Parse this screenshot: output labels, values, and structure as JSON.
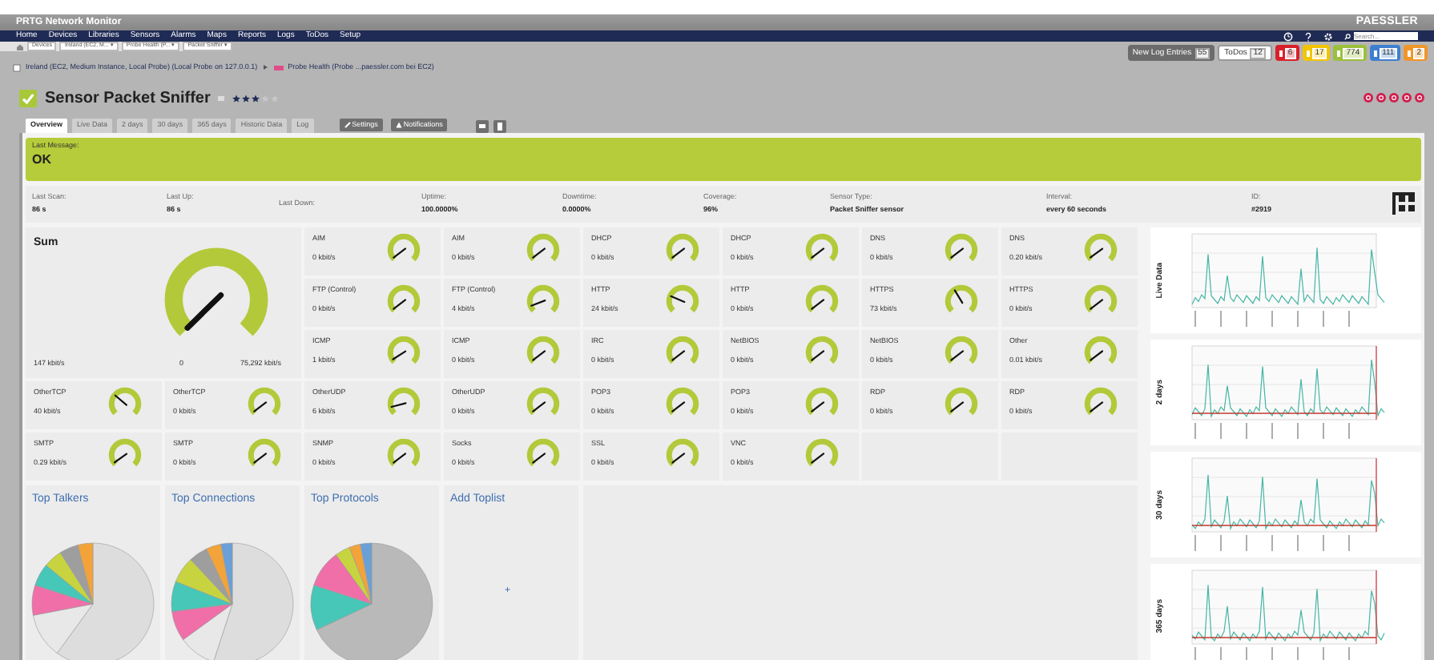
{
  "app_title": "PRTG Network Monitor",
  "logo": "PAESSLER",
  "menu": [
    "Home",
    "Devices",
    "Libraries",
    "Sensors",
    "Alarms",
    "Maps",
    "Reports",
    "Logs",
    "ToDos",
    "Setup"
  ],
  "search": {
    "placeholder": "Search..."
  },
  "breadcrumbs": [
    "Devices",
    "Ireland (EC2, M... ▾",
    "Probe Health (P... ▾",
    "Packet Sniffer ▾"
  ],
  "badges": [
    {
      "kind": "log",
      "label": "New Log Entries",
      "count": "55"
    },
    {
      "kind": "todo",
      "label": "ToDos",
      "count": "12"
    },
    {
      "kind": "status",
      "count": "6",
      "color": "#d9202a"
    },
    {
      "kind": "status",
      "count": "17",
      "color": "#f2c500"
    },
    {
      "kind": "status",
      "count": "774",
      "color": "#9cc03c"
    },
    {
      "kind": "status",
      "count": "111",
      "color": "#3f7fd0"
    },
    {
      "kind": "status",
      "count": "2",
      "color": "#f0962a"
    }
  ],
  "path": [
    "Ireland (EC2, Medium Instance, Local Probe) (Local Probe on 127.0.0.1)",
    "Probe Health (Probe ...paessler.com bei EC2)"
  ],
  "sensor": {
    "title": "Sensor Packet Sniffer",
    "stars": 3
  },
  "tabs": [
    {
      "label": "Overview",
      "selected": true
    },
    {
      "label": "Live Data",
      "selected": false
    },
    {
      "label": "2 days",
      "selected": false
    },
    {
      "label": "30 days",
      "selected": false
    },
    {
      "label": "365 days",
      "selected": false
    },
    {
      "label": "Historic Data",
      "selected": false
    },
    {
      "label": "Log",
      "selected": false
    }
  ],
  "actions": [
    "Settings",
    "Notifications"
  ],
  "last_message": {
    "label": "Last Message:",
    "value": "OK"
  },
  "info": [
    {
      "label": "Last Scan:",
      "value": "86 s"
    },
    {
      "label": "Last Up:",
      "value": "86 s"
    },
    {
      "label": "Last Down:"
    },
    {
      "label": "Uptime:",
      "value": "100.0000%"
    },
    {
      "label": "Downtime:",
      "value": "0.0000%"
    },
    {
      "label": "Coverage:",
      "value": "96%"
    },
    {
      "label": "Sensor Type:",
      "value": "Packet Sniffer sensor"
    },
    {
      "label": "Interval:",
      "value": "every 60 seconds"
    },
    {
      "label": "ID:",
      "value": "#2919"
    }
  ],
  "sum_gauge": {
    "title": "Sum",
    "reading": "147 kbit/s",
    "min": "0",
    "max": "75,292 kbit/s"
  },
  "gauges": [
    {
      "name": "AIM",
      "reading": "0 kbit/s"
    },
    {
      "name": "AIM",
      "reading": "0 kbit/s"
    },
    {
      "name": "DHCP",
      "reading": "0 kbit/s"
    },
    {
      "name": "DHCP",
      "reading": "0 kbit/s"
    },
    {
      "name": "DNS",
      "reading": "0 kbit/s"
    },
    {
      "name": "DNS",
      "reading": "0.20 kbit/s"
    },
    {
      "name": "FTP (Control)",
      "reading": "0 kbit/s"
    },
    {
      "name": "FTP (Control)",
      "reading": "4 kbit/s"
    },
    {
      "name": "HTTP",
      "reading": "24 kbit/s"
    },
    {
      "name": "HTTP",
      "reading": "0 kbit/s"
    },
    {
      "name": "HTTPS",
      "reading": "73 kbit/s"
    },
    {
      "name": "HTTPS",
      "reading": "0 kbit/s"
    },
    {
      "name": "ICMP",
      "reading": "1 kbit/s"
    },
    {
      "name": "ICMP",
      "reading": "0 kbit/s"
    },
    {
      "name": "IRC",
      "reading": "0 kbit/s"
    },
    {
      "name": "NetBIOS",
      "reading": "0 kbit/s"
    },
    {
      "name": "NetBIOS",
      "reading": "0 kbit/s"
    },
    {
      "name": "Other",
      "reading": "0.01 kbit/s"
    },
    {
      "name": "OtherTCP",
      "reading": "40 kbit/s"
    },
    {
      "name": "OtherTCP",
      "reading": "0 kbit/s"
    },
    {
      "name": "OtherUDP",
      "reading": "6 kbit/s"
    },
    {
      "name": "OtherUDP",
      "reading": "0 kbit/s"
    },
    {
      "name": "POP3",
      "reading": "0 kbit/s"
    },
    {
      "name": "POP3",
      "reading": "0 kbit/s"
    },
    {
      "name": "RDP",
      "reading": "0 kbit/s"
    },
    {
      "name": "RDP",
      "reading": "0 kbit/s"
    },
    {
      "name": "SMTP",
      "reading": "0.29 kbit/s"
    },
    {
      "name": "SMTP",
      "reading": "0 kbit/s"
    },
    {
      "name": "SNMP",
      "reading": "0 kbit/s"
    },
    {
      "name": "Socks",
      "reading": "0 kbit/s"
    },
    {
      "name": "SSL",
      "reading": "0 kbit/s"
    },
    {
      "name": "VNC",
      "reading": "0 kbit/s"
    }
  ],
  "graphs": [
    {
      "label": "Live Data"
    },
    {
      "label": "2 days"
    },
    {
      "label": "30 days"
    },
    {
      "label": "365 days"
    }
  ],
  "toplists": [
    {
      "kind": "pie",
      "title": "Top Talkers"
    },
    {
      "kind": "pie",
      "title": "Top Connections"
    },
    {
      "kind": "pie",
      "title": "Top Protocols"
    },
    {
      "kind": "add",
      "title": "Add Toplist",
      "icon": "+"
    }
  ]
}
